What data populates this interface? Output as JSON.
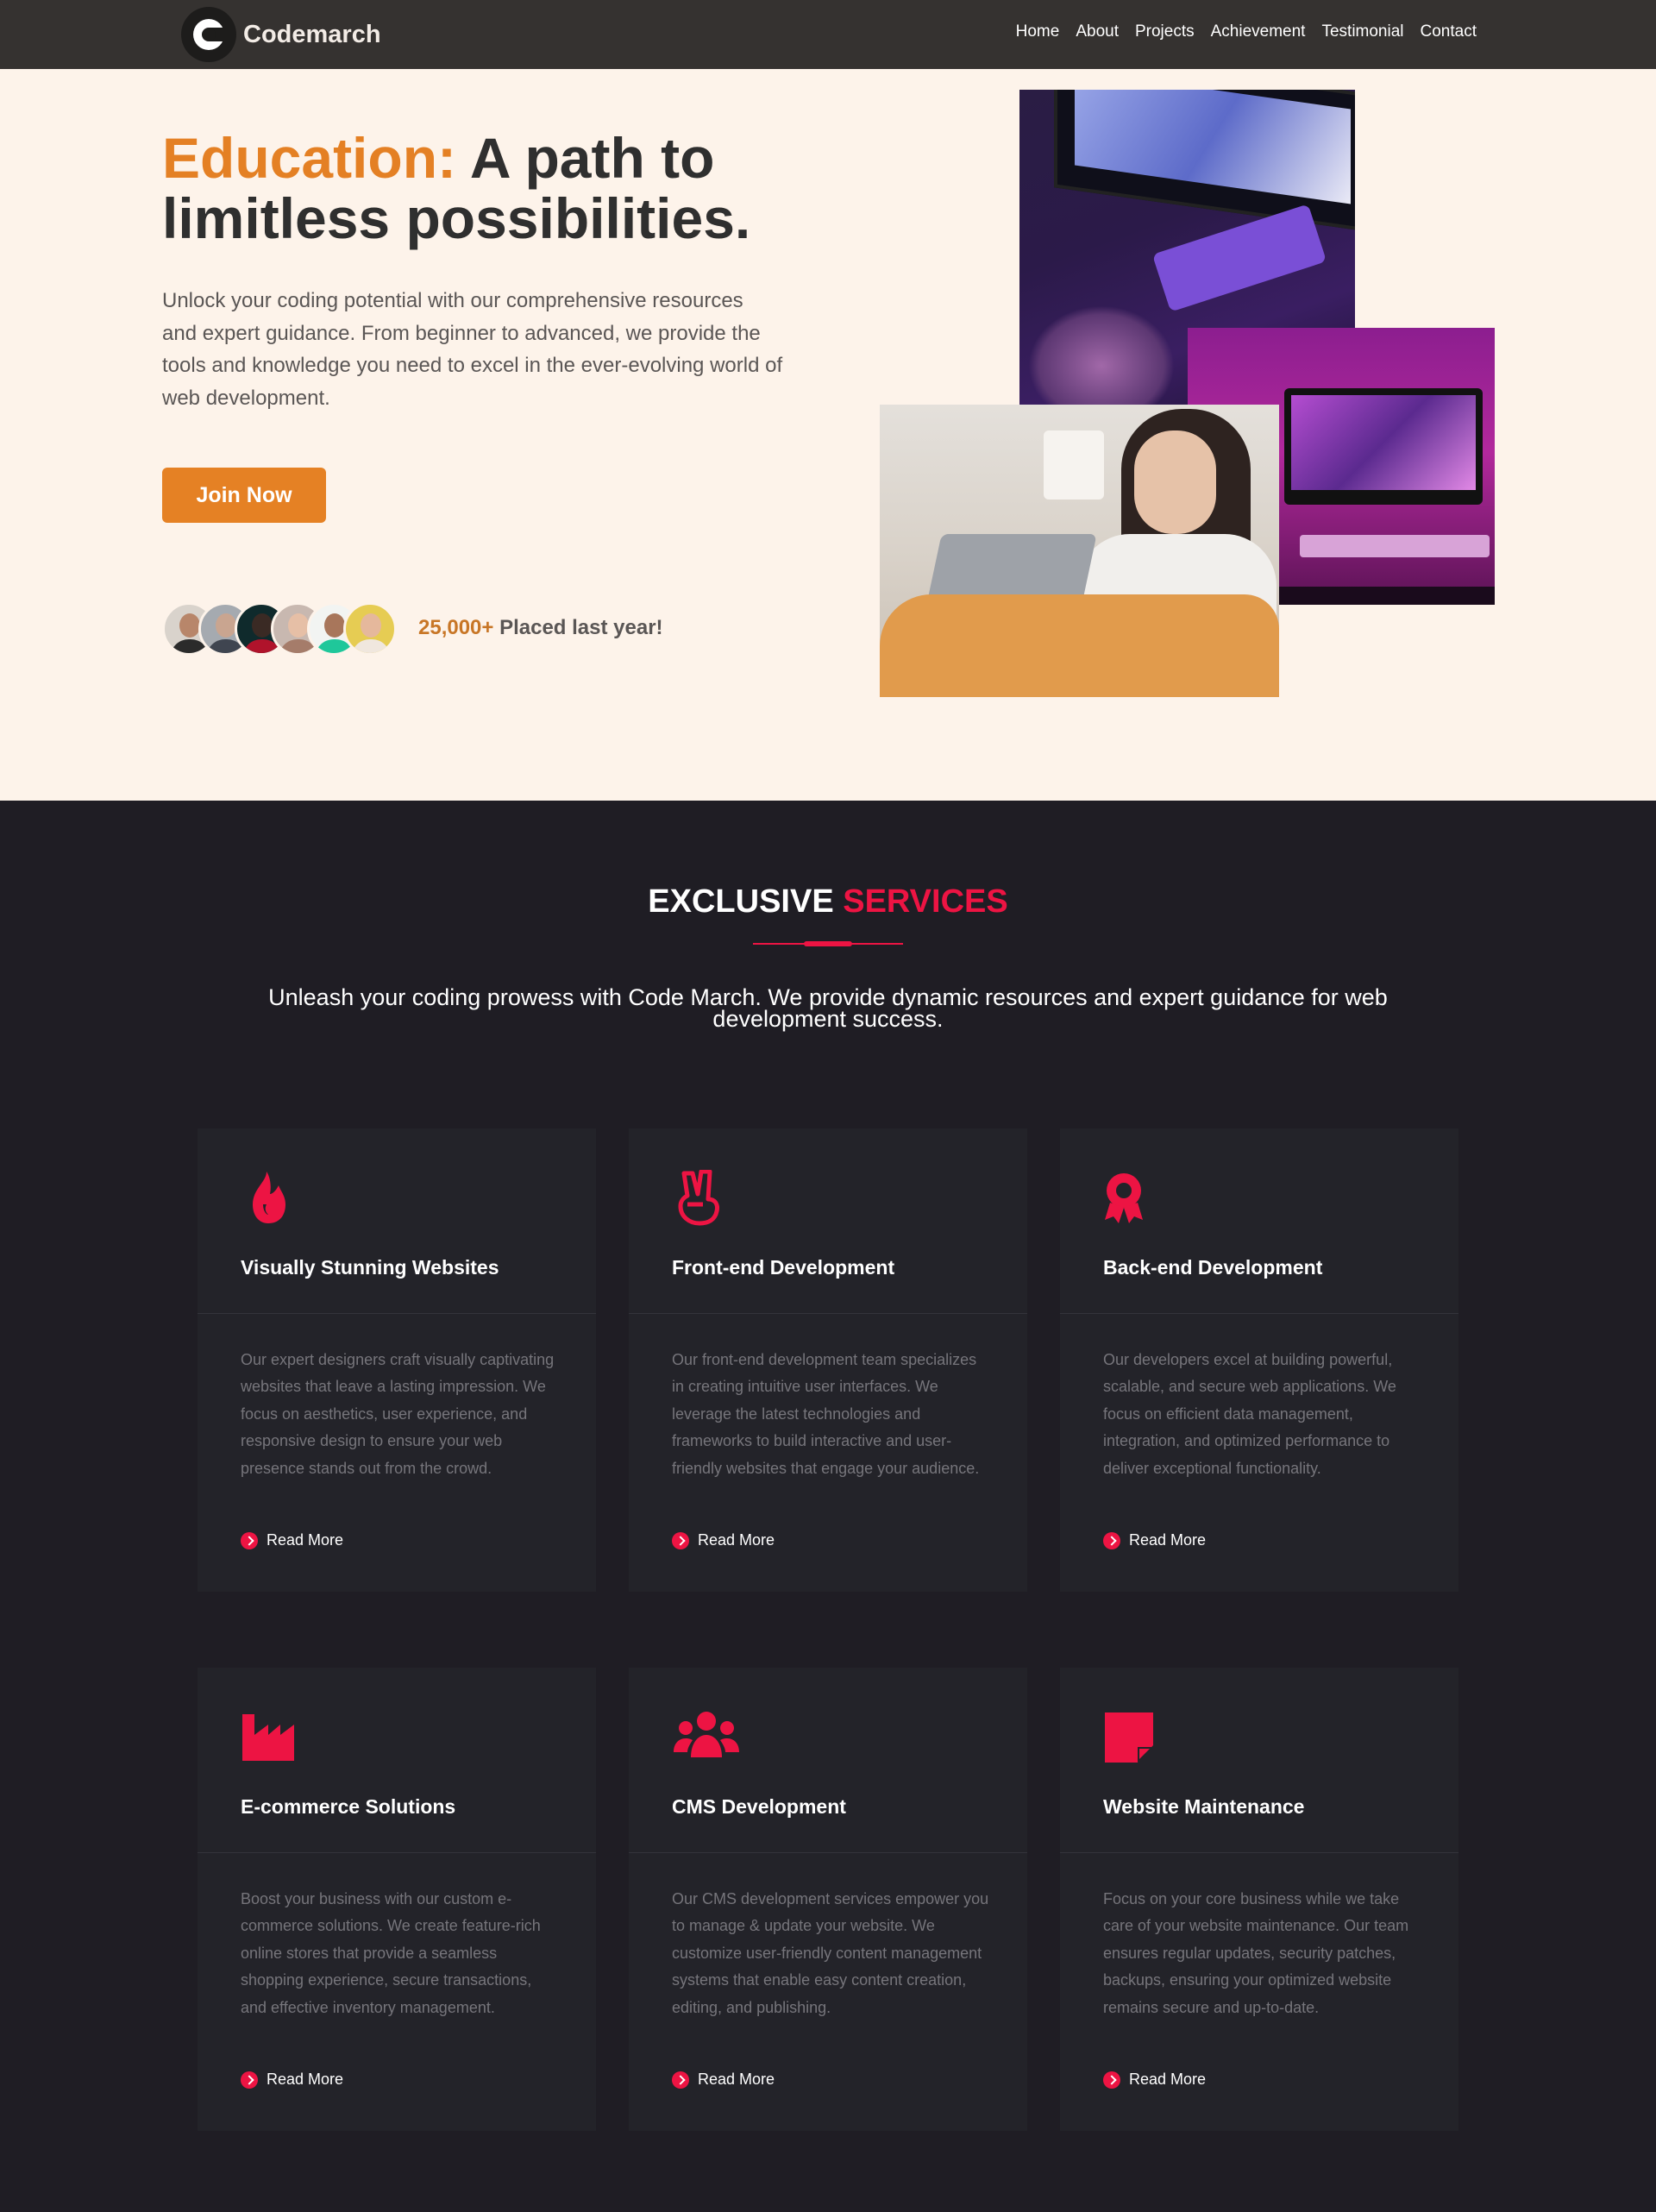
{
  "nav": {
    "brand": "Codemarch",
    "links": [
      "Home",
      "About",
      "Projects",
      "Achievement",
      "Testimonial",
      "Contact"
    ]
  },
  "hero": {
    "title_accent": "Education:",
    "title_rest": " A path to limitless possibilities.",
    "lead": "Unlock your coding potential with our comprehensive resources and expert guidance. From beginner to advanced, we provide the tools and knowledge you need to excel in the ever-evolving world of web development.",
    "cta": "Join Now",
    "placed_count": "25,000+",
    "placed_text": " Placed last year!"
  },
  "services": {
    "title_white": "EXCLUSIVE ",
    "title_accent": "SERVICES",
    "subtitle": "Unleash your coding prowess with Code March. We provide dynamic resources and expert guidance for web development success.",
    "accent_color": "#ed1443",
    "read_more": "Read More",
    "cards": [
      {
        "icon": "fire-icon",
        "title": "Visually Stunning Websites",
        "text": "Our expert designers craft visually captivating websites that leave a lasting impression. We focus on aesthetics, user experience, and responsive design to ensure your web presence stands out from the crowd."
      },
      {
        "icon": "peace-hand-icon",
        "title": "Front-end Development",
        "text": "Our front-end development team specializes in creating intuitive user interfaces. We leverage the latest technologies and frameworks to build interactive and user-friendly websites that engage your audience."
      },
      {
        "icon": "award-ribbon-icon",
        "title": "Back-end Development",
        "text": "Our developers excel at building powerful, scalable, and secure web applications. We focus on efficient data management, integration, and optimized performance to deliver exceptional functionality."
      },
      {
        "icon": "factory-icon",
        "title": "E-commerce Solutions",
        "text": "Boost your business with our custom e-commerce solutions. We create feature-rich online stores that provide a seamless shopping experience, secure transactions, and effective inventory management."
      },
      {
        "icon": "users-icon",
        "title": "CMS Development",
        "text": "Our CMS development services empower you to manage & update your website. We customize user-friendly content management systems that enable easy content creation, editing, and publishing."
      },
      {
        "icon": "sticky-note-icon",
        "title": "Website Maintenance",
        "text": "Focus on your core business while we take care of your website maintenance. Our team ensures regular updates, security patches, backups, ensuring your optimized website remains secure and up-to-date."
      }
    ]
  }
}
